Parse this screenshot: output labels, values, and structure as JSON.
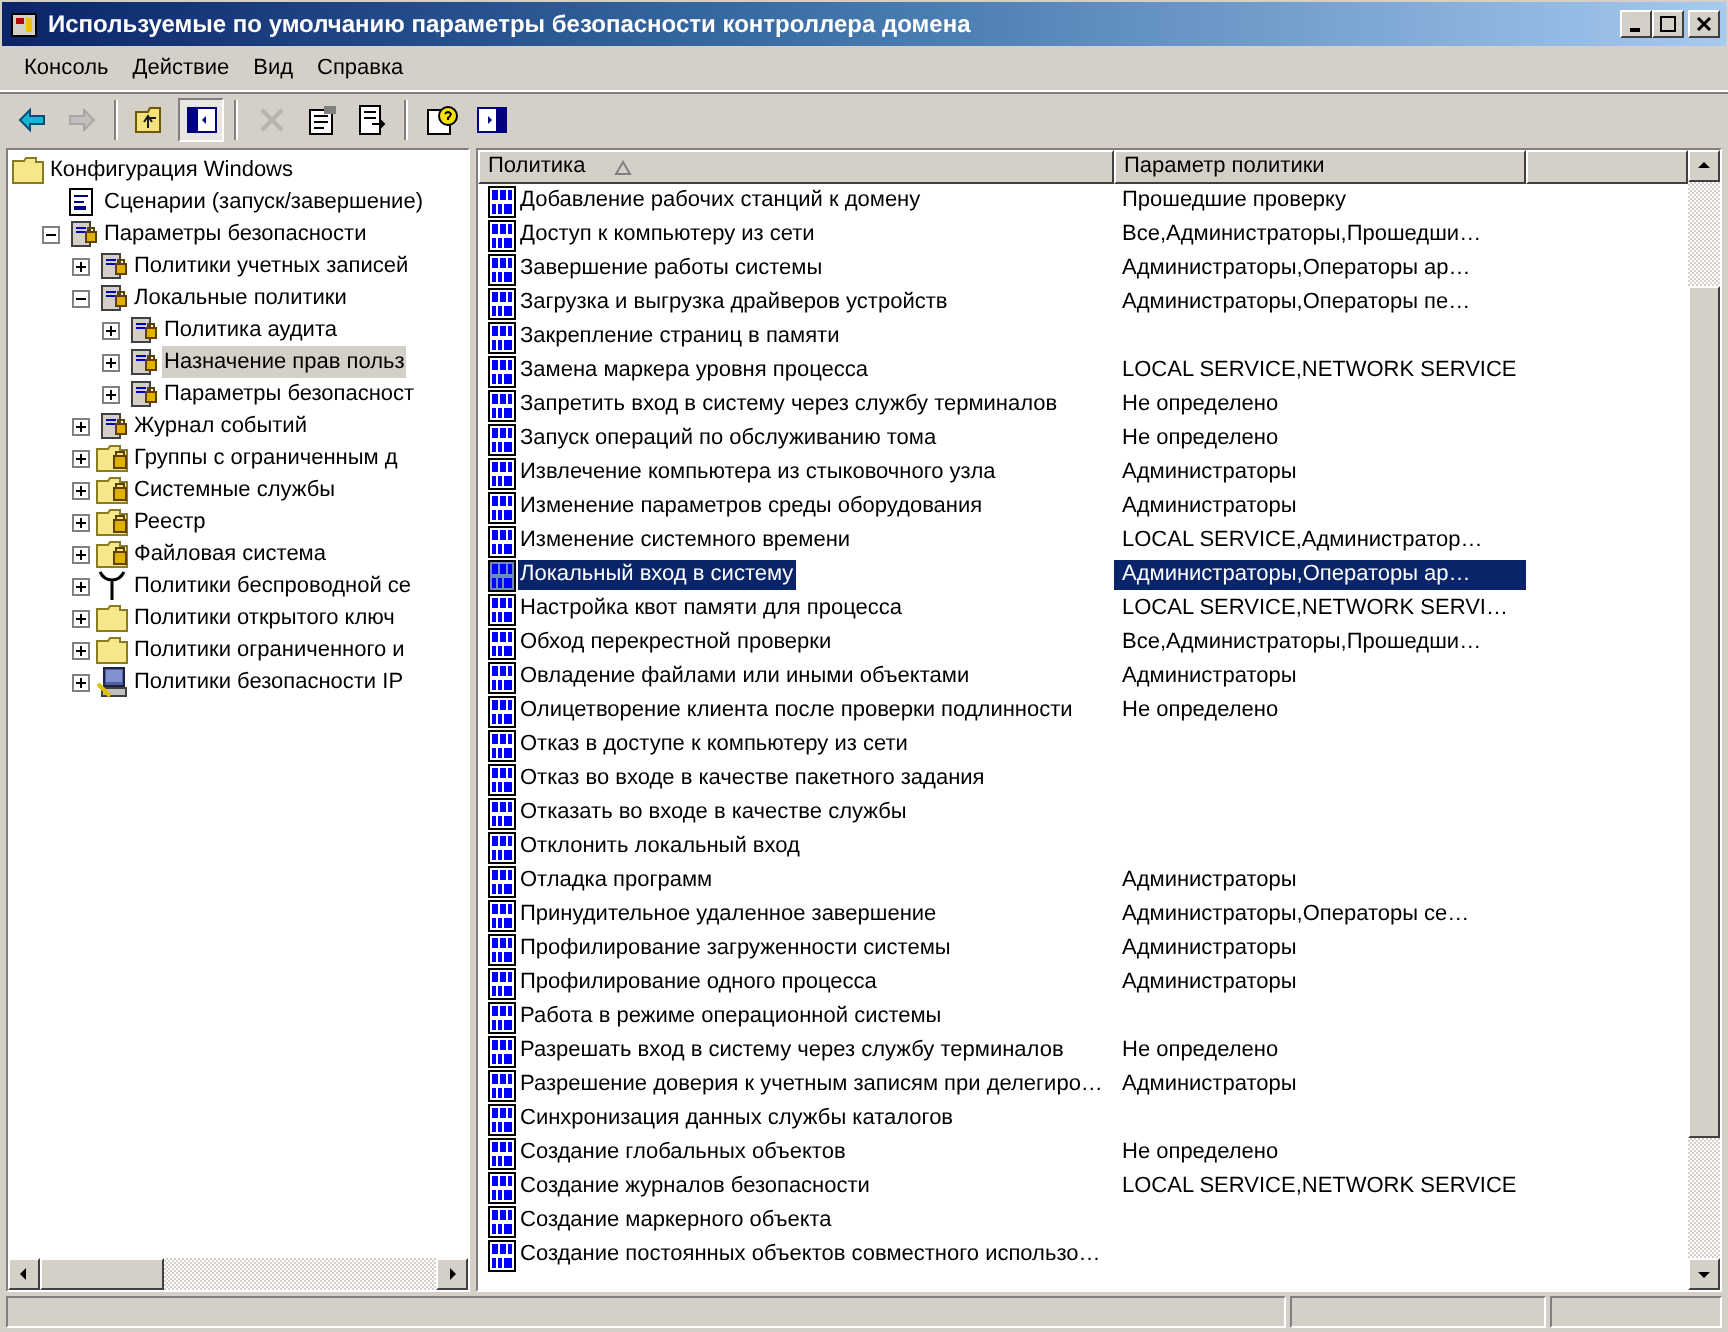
{
  "window": {
    "title": "Используемые по умолчанию параметры безопасности контроллера домена"
  },
  "menu": [
    "Консоль",
    "Действие",
    "Вид",
    "Справка"
  ],
  "toolbar": [
    {
      "kind": "back",
      "disabled": false,
      "pressed": false
    },
    {
      "kind": "forward",
      "disabled": true,
      "pressed": false
    },
    {
      "kind": "sep"
    },
    {
      "kind": "up",
      "disabled": false,
      "pressed": false
    },
    {
      "kind": "tree",
      "disabled": false,
      "pressed": true
    },
    {
      "kind": "sep"
    },
    {
      "kind": "delete",
      "disabled": true,
      "pressed": false
    },
    {
      "kind": "properties",
      "disabled": false,
      "pressed": false
    },
    {
      "kind": "export",
      "disabled": false,
      "pressed": false
    },
    {
      "kind": "sep"
    },
    {
      "kind": "help",
      "disabled": false,
      "pressed": false
    },
    {
      "kind": "pane",
      "disabled": false,
      "pressed": false
    }
  ],
  "tree": [
    {
      "label": "Конфигурация Windows",
      "kind": "folder",
      "selected": false,
      "children": [
        {
          "label": "Сценарии (запуск/завершение)",
          "kind": "script",
          "selected": false
        },
        {
          "label": "Параметры безопасности",
          "kind": "server",
          "selected": false,
          "expanded": true,
          "children": [
            {
              "label": "Политики учетных записей",
              "kind": "server",
              "selected": false,
              "expanded": false
            },
            {
              "label": "Локальные политики",
              "kind": "server",
              "selected": false,
              "expanded": true,
              "children": [
                {
                  "label": "Политика аудита",
                  "kind": "server",
                  "selected": false,
                  "expanded": false
                },
                {
                  "label": "Назначение прав польз",
                  "kind": "server",
                  "selected": true,
                  "expanded": false
                },
                {
                  "label": "Параметры безопасност",
                  "kind": "server",
                  "selected": false,
                  "expanded": false
                }
              ]
            },
            {
              "label": "Журнал событий",
              "kind": "server",
              "selected": false,
              "expanded": false
            },
            {
              "label": "Группы с ограниченным д",
              "kind": "lockfolder",
              "selected": false,
              "expanded": false
            },
            {
              "label": "Системные службы",
              "kind": "lockfolder",
              "selected": false,
              "expanded": false
            },
            {
              "label": "Реестр",
              "kind": "lockfolder",
              "selected": false,
              "expanded": false
            },
            {
              "label": "Файловая система",
              "kind": "lockfolder",
              "selected": false,
              "expanded": false
            },
            {
              "label": "Политики беспроводной се",
              "kind": "antenna",
              "selected": false,
              "expanded": false
            },
            {
              "label": "Политики открытого ключ",
              "kind": "folder",
              "selected": false,
              "expanded": false
            },
            {
              "label": "Политики ограниченного и",
              "kind": "folder",
              "selected": false,
              "expanded": false
            },
            {
              "label": "Политики безопасности IP",
              "kind": "ipsec",
              "selected": false,
              "expanded": false
            }
          ]
        }
      ]
    }
  ],
  "table": {
    "columns": [
      {
        "label": "Политика",
        "sorted": true
      },
      {
        "label": "Параметр политики",
        "sorted": false
      }
    ],
    "rows": [
      {
        "policy": "Добавление рабочих станций к домену",
        "setting": "Прошедшие проверку",
        "selected": false
      },
      {
        "policy": "Доступ к компьютеру из сети",
        "setting": "Все,Администраторы,Прошедши…",
        "selected": false
      },
      {
        "policy": "Завершение работы системы",
        "setting": "Администраторы,Операторы ар…",
        "selected": false
      },
      {
        "policy": "Загрузка и выгрузка драйверов устройств",
        "setting": "Администраторы,Операторы пе…",
        "selected": false
      },
      {
        "policy": "Закрепление страниц в памяти",
        "selected": false
      },
      {
        "policy": "Замена маркера уровня процесса",
        "setting": "LOCAL SERVICE,NETWORK SERVICE",
        "selected": false
      },
      {
        "policy": "Запретить вход в систему через службу терминалов",
        "setting": "Не определено",
        "selected": false
      },
      {
        "policy": "Запуск операций по обслуживанию тома",
        "setting": "Не определено",
        "selected": false
      },
      {
        "policy": "Извлечение компьютера из стыковочного узла",
        "setting": "Администраторы",
        "selected": false
      },
      {
        "policy": "Изменение параметров среды оборудования",
        "setting": "Администраторы",
        "selected": false
      },
      {
        "policy": "Изменение системного времени",
        "setting": "LOCAL SERVICE,Администратор…",
        "selected": false
      },
      {
        "policy": "Локальный вход в систему",
        "setting": "Администраторы,Операторы ар…",
        "selected": true
      },
      {
        "policy": "Настройка квот памяти для процесса",
        "setting": "LOCAL SERVICE,NETWORK SERVI…",
        "selected": false
      },
      {
        "policy": "Обход перекрестной проверки",
        "setting": "Все,Администраторы,Прошедши…",
        "selected": false
      },
      {
        "policy": "Овладение файлами или иными объектами",
        "setting": "Администраторы",
        "selected": false
      },
      {
        "policy": "Олицетворение клиента после проверки подлинности",
        "setting": "Не определено",
        "selected": false
      },
      {
        "policy": "Отказ в доступе к компьютеру из сети",
        "selected": false
      },
      {
        "policy": "Отказ во входе в качестве пакетного задания",
        "selected": false
      },
      {
        "policy": "Отказать во входе в качестве службы",
        "selected": false
      },
      {
        "policy": "Отклонить локальный вход",
        "selected": false
      },
      {
        "policy": "Отладка программ",
        "setting": "Администраторы",
        "selected": false
      },
      {
        "policy": "Принудительное удаленное завершение",
        "setting": "Администраторы,Операторы се…",
        "selected": false
      },
      {
        "policy": "Профилирование загруженности системы",
        "setting": "Администраторы",
        "selected": false
      },
      {
        "policy": "Профилирование одного процесса",
        "setting": "Администраторы",
        "selected": false
      },
      {
        "policy": "Работа в режиме операционной системы",
        "selected": false
      },
      {
        "policy": "Разрешать вход в систему через службу терминалов",
        "setting": "Не определено",
        "selected": false
      },
      {
        "policy": "Разрешение доверия к учетным записям при делегиро…",
        "setting": "Администраторы",
        "selected": false
      },
      {
        "policy": "Синхронизация данных службы каталогов",
        "selected": false
      },
      {
        "policy": "Создание глобальных объектов",
        "setting": "Не определено",
        "selected": false
      },
      {
        "policy": "Создание журналов безопасности",
        "setting": "LOCAL SERVICE,NETWORK SERVICE",
        "selected": false
      },
      {
        "policy": "Создание маркерного объекта",
        "selected": false
      },
      {
        "policy": "Создание постоянных объектов совместного использо…",
        "selected": false
      }
    ]
  }
}
